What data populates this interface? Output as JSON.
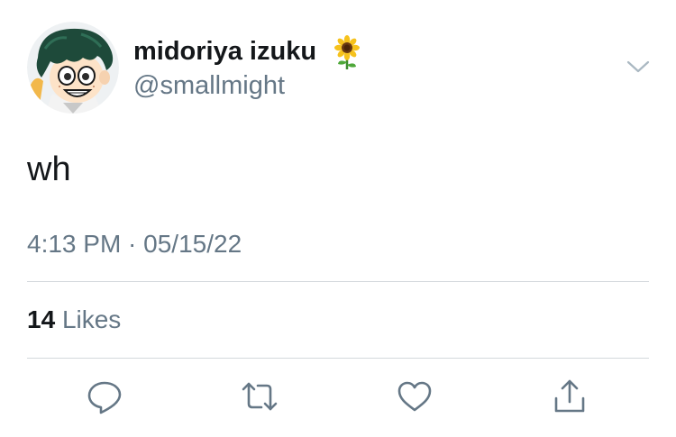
{
  "user": {
    "display_name": "midoriya izuku",
    "name_emoji": "sunflower-icon",
    "handle": "@smallmight"
  },
  "tweet": {
    "text": "wh",
    "time": "4:13 PM · 05/15/22"
  },
  "stats": {
    "likes_count": "14",
    "likes_label": "Likes"
  },
  "actions": [
    "reply-icon",
    "retweet-icon",
    "like-icon",
    "share-icon"
  ],
  "colors": {
    "primary_text": "#14171a",
    "secondary_text": "#657786",
    "divider": "#d3d8dc",
    "icon": "#657786"
  }
}
